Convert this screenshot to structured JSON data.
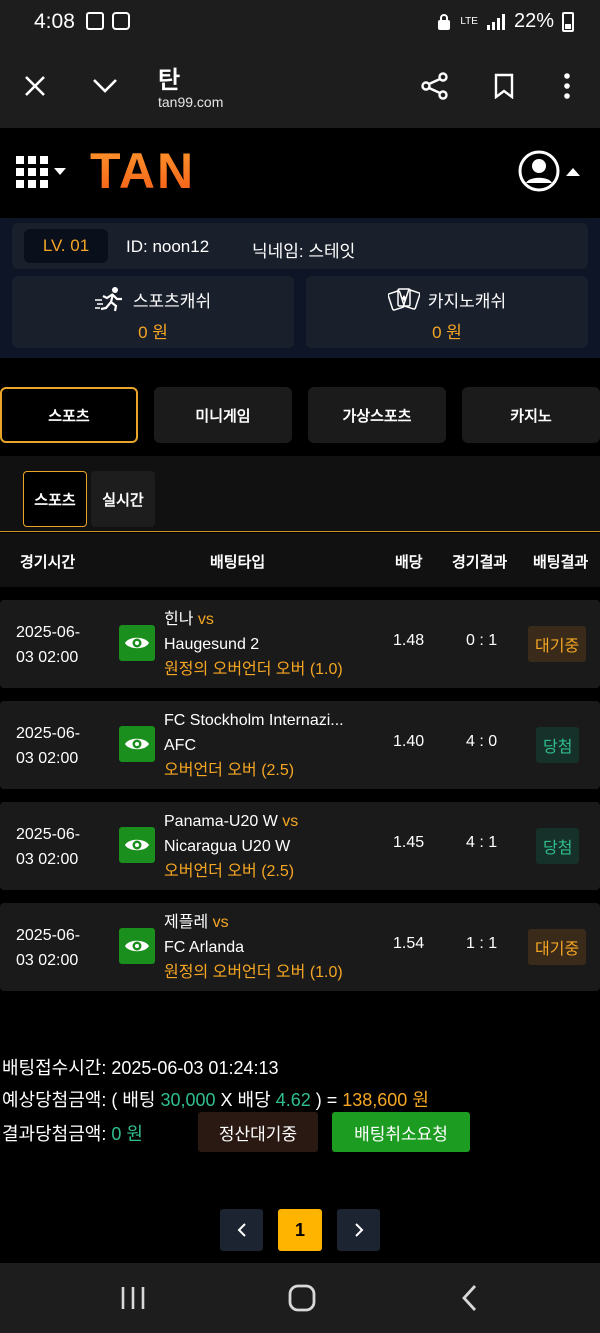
{
  "status_bar": {
    "time": "4:08",
    "battery": "22%",
    "network": "LTE"
  },
  "browser": {
    "title": "탄",
    "url": "tan99.com"
  },
  "site": {
    "logo": "TAN"
  },
  "user": {
    "level": "LV. 01",
    "id": "ID: noon12",
    "nickname": "닉네임: 스테잇"
  },
  "cash": {
    "sports": {
      "label": "스포츠캐쉬",
      "value": "0 원"
    },
    "casino": {
      "label": "카지노캐쉬",
      "value": "0 원"
    }
  },
  "main_tabs": [
    "스포츠",
    "미니게임",
    "가상스포츠",
    "카지노"
  ],
  "sub_tabs": [
    "스포츠",
    "실시간"
  ],
  "table_headers": [
    "경기시간",
    "배팅타입",
    "배당",
    "경기결과",
    "배팅결과"
  ],
  "vs_label": "vs",
  "rows": [
    {
      "date": "2025-06-",
      "time": "03 02:00",
      "team1": "힌나",
      "team2": "Haugesund 2",
      "bet_type": "원정의 오버언더 오버 (1.0)",
      "odds": "1.48",
      "score": "0 : 1",
      "result": "대기중"
    },
    {
      "date": "2025-06-",
      "time": "03 02:00",
      "team1": "FC Stockholm Internazi...",
      "team2": "AFC",
      "bet_type": "오버언더 오버 (2.5)",
      "odds": "1.40",
      "score": "4 : 0",
      "result": "당첨"
    },
    {
      "date": "2025-06-",
      "time": "03 02:00",
      "team1": "Panama-U20 W",
      "team2": "Nicaragua U20 W",
      "bet_type": "오버언더 오버 (2.5)",
      "odds": "1.45",
      "score": "4 : 1",
      "result": "당첨"
    },
    {
      "date": "2025-06-",
      "time": "03 02:00",
      "team1": "제플레",
      "team2": "FC Arlanda",
      "bet_type": "원정의 오버언더 오버 (1.0)",
      "odds": "1.54",
      "score": "1 : 1",
      "result": "대기중"
    }
  ],
  "summary": {
    "received_label": "배팅접수시간: 2025-06-03 01:24:13",
    "expected_prefix": "예상당첨금액: ( 배팅 ",
    "bet_amount": "30,000",
    "x_odds_label": " X 배당 ",
    "total_odds": "4.62",
    "equals": " ) = ",
    "expected_amount": "138,600 원",
    "result_label": "결과당첨금액: ",
    "result_amount": "0 원",
    "settle_button": "정산대기중",
    "cancel_button": "배팅취소요청"
  },
  "pagination": {
    "prev": "‹",
    "current": "1",
    "next": "›"
  },
  "colors": {
    "accent": "#f5a623",
    "green": "#2fbf8c",
    "eye_button": "#1a8f1d",
    "cancel_button": "#1d9c22"
  }
}
